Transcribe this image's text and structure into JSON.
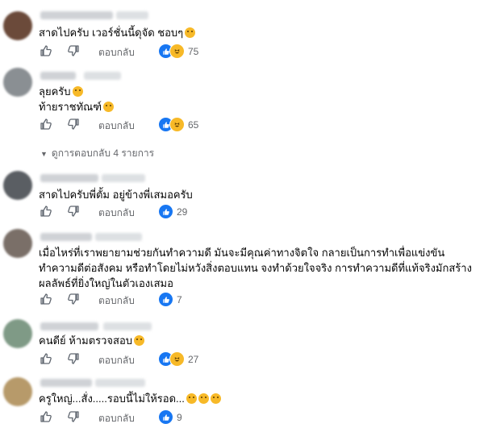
{
  "comments": [
    {
      "text_lines": [
        "สาดไปครับ เวอร์ชั่นนี้ดุจัด ชอบๆ"
      ],
      "reply_label": "ตอบกลับ",
      "reaction_count": "75",
      "reactions": [
        "like",
        "haha"
      ],
      "avatar_color": "#6b4a3a"
    },
    {
      "text_lines": [
        "ลุยครับ",
        "ท้ายราชทัณฑ์"
      ],
      "reply_label": "ตอบกลับ",
      "reaction_count": "65",
      "reactions": [
        "like",
        "haha"
      ],
      "avatar_color": "#8a8f93"
    },
    {
      "text_lines": [
        "สาดไปครับพี่ตั้ม อยู่ข้างพี่เสมอครับ"
      ],
      "reply_label": "ตอบกลับ",
      "reaction_count": "29",
      "reactions": [
        "like"
      ],
      "avatar_color": "#5a5e63"
    },
    {
      "text_lines": [
        "เมื่อไหร่ที่เราพยายามช่วยกันทำความดี มันจะมีคุณค่าทางจิตใจ กลายเป็นการทำเพื่อแข่งขัน",
        "ทำความดีต่อสังคม หรือทำโดยไม่หวังสิ่งตอบแทน จงทำด้วยใจจริง การทำความดีที่แท้จริงมักสร้าง",
        "ผลลัพธ์ที่ยิ่งใหญ่ในตัวเองเสมอ"
      ],
      "reply_label": "ตอบกลับ",
      "reaction_count": "7",
      "reactions": [
        "like"
      ],
      "avatar_color": "#7a6f68"
    },
    {
      "text_lines": [
        "คนดีย์ ห้ามตรวจสอบ"
      ],
      "reply_label": "ตอบกลับ",
      "reaction_count": "27",
      "reactions": [
        "like",
        "haha"
      ],
      "avatar_color": "#7f9a86"
    },
    {
      "text_lines": [
        "ครูใหญ่...สั่ง.....รอบนี้ไม่ให้รอด..."
      ],
      "reply_label": "ตอบกลับ",
      "reaction_count": "9",
      "reactions": [
        "like"
      ],
      "avatar_color": "#b79a6a"
    }
  ],
  "view_replies": "ดูการตอบกลับ 4 รายการ",
  "icons": {
    "like": "thumbs-up-icon",
    "dislike": "thumbs-down-icon",
    "chevron": "chevron-down-icon"
  }
}
